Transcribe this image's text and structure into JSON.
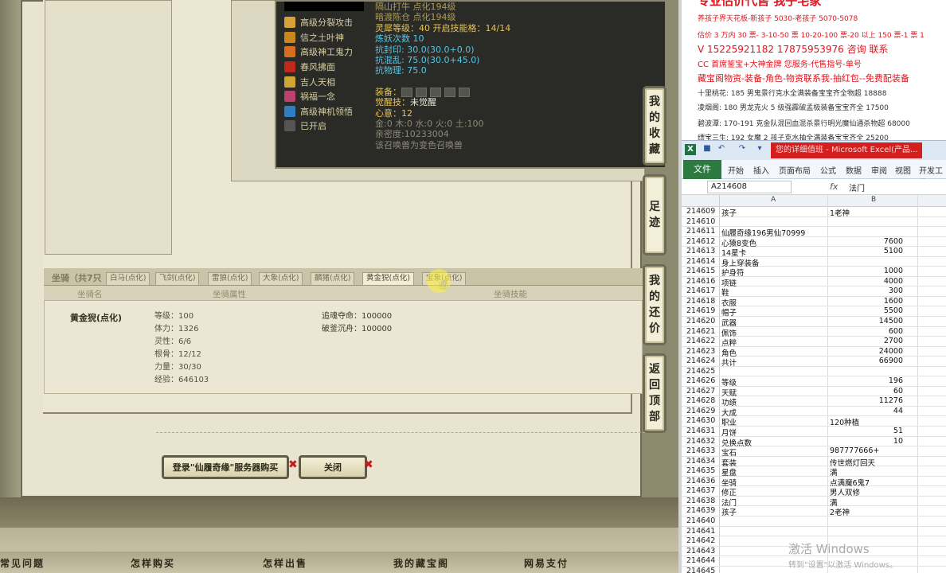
{
  "tooltip": {
    "skills": [
      {
        "label": "高级分裂攻击",
        "color": "#d8a23a"
      },
      {
        "label": "信之土叶神",
        "color": "#c9871e"
      },
      {
        "label": "高级神工鬼力",
        "color": "#d66e1e"
      },
      {
        "label": "春风拂面",
        "color": "#c3281f"
      },
      {
        "label": "吉人天相",
        "color": "#d0a534"
      },
      {
        "label": "祸福一念",
        "color": "#b9436e"
      },
      {
        "label": "高级神机领悟",
        "color": "#2d7fc2"
      },
      {
        "label": "已开启",
        "color": "#555555"
      }
    ],
    "stats": {
      "line1": "隔山打牛 点化194级",
      "line2": "暗渡陈仓 点化194级",
      "level": "灵犀等级：40  开启技能格：14/14",
      "refine": "炼妖次数 10",
      "seal": "抗封印: 30.0(30.0+0.0)",
      "chaos": "抗混乱: 75.0(30.0+45.0)",
      "physical": "抗物理: 75.0",
      "equip": "装备：",
      "awaken_label": "觉醒技：",
      "awaken_value": "未觉醒",
      "mind": "心意：12",
      "elements": "金:0 木:0 水:0 火:0 土:100",
      "intimacy": "亲密度:10233004",
      "note": "该召唤兽为变色召唤兽"
    }
  },
  "side_buttons": [
    {
      "label": [
        "我",
        "的",
        "收",
        "藏"
      ]
    },
    {
      "label": [
        "足",
        "迹"
      ]
    },
    {
      "label": [
        "我",
        "的",
        "还",
        "价"
      ]
    },
    {
      "label": [
        "返",
        "回",
        "顶",
        "部"
      ]
    }
  ],
  "mount": {
    "title": "坐骑（共7只",
    "tabs": [
      "白马(点化)",
      "飞剑(点化)",
      "雷狼(点化)",
      "大象(点化)",
      "麟猪(点化)",
      "黄金猊(点化)",
      "宝象(点化)"
    ],
    "headers": {
      "name": "坐骑名",
      "attrs": "坐骑属性",
      "skills": "坐骑技能"
    },
    "name": "黄金猊(点化)",
    "attrs": [
      "等级：100",
      "体力：1326",
      "灵性：6/6",
      "根骨：12/12",
      "力量：30/30",
      "经验：646103"
    ],
    "skills": [
      "追魂夺命：100000",
      "破釜沉舟：100000"
    ]
  },
  "buttons": {
    "login": "登录\"仙履奇缘\"服务器购买",
    "close": "关闭"
  },
  "footer_nav": [
    "常见问题",
    "怎样购买",
    "怎样出售",
    "我的藏宝阁",
    "网易支付"
  ],
  "notes": {
    "lines": [
      {
        "text": "专业估价代售 我子宅家",
        "cls": "red",
        "size": 15
      },
      {
        "text": "养孩子界天花板-新孩子 5030-老孩子 5070-5078",
        "cls": "red",
        "size": 9
      },
      {
        "text": "估价 3 万内 30 票- 3-10-50 票  10-20-100 票-20 以上 150 票-1 票 1",
        "cls": "red",
        "size": 9
      },
      {
        "text": "V 15225921182     17875953976  咨询  联系",
        "cls": "red",
        "size": 12
      },
      {
        "text": "CC 首席鉴宝+大神金牌   您服务-代售指号-单号",
        "cls": "red",
        "size": 10
      },
      {
        "text": "藏宝阁物资-装备-角色-物资联系我-抽红包--免费配装备",
        "cls": "red",
        "size": 11
      },
      {
        "text": "十里桃花: 185 男鬼景行克水全满装备宝宝齐全物超 18888",
        "cls": "dark",
        "size": 9
      },
      {
        "text": "凌烟阁: 180 男龙克火 5 级强霹破孟极装备宝宝齐全 17500",
        "cls": "dark",
        "size": 9
      },
      {
        "text": "碧波潭: 170-191 克金队混回血混杀景行明光魔仙通杀物超 68000",
        "cls": "dark",
        "size": 9
      },
      {
        "text": "缥宝三生: 192 女魔 2 孩子克水抽全满装备宝宝齐全 25200",
        "cls": "dark",
        "size": 9
      }
    ]
  },
  "excel": {
    "title": "您的详细值班 - Microsoft Excel(产品...",
    "ribbon_tabs": [
      "开始",
      "插入",
      "页面布局",
      "公式",
      "数据",
      "审阅",
      "视图",
      "开发工具"
    ],
    "file_tab": "文件",
    "name_box": "A214608",
    "formula_value": "法门",
    "fx": "fx",
    "col_a": "A",
    "col_b": "B",
    "rows": [
      {
        "n": "214609",
        "a": "孩子",
        "b": "1老神",
        "num": false
      },
      {
        "n": "214610",
        "a": "",
        "b": "",
        "num": false
      },
      {
        "n": "214611",
        "a": "仙履奇缘196男仙70999",
        "b": "",
        "num": false
      },
      {
        "n": "214612",
        "a": "心猿8变色",
        "b": "7600",
        "num": true
      },
      {
        "n": "214613",
        "a": "14星卡",
        "b": "5100",
        "num": true
      },
      {
        "n": "214614",
        "a": "身上穿装备",
        "b": "",
        "num": false
      },
      {
        "n": "214615",
        "a": "护身符",
        "b": "1000",
        "num": true
      },
      {
        "n": "214616",
        "a": "项链",
        "b": "4000",
        "num": true
      },
      {
        "n": "214617",
        "a": "鞋",
        "b": "300",
        "num": true
      },
      {
        "n": "214618",
        "a": "衣服",
        "b": "1600",
        "num": true
      },
      {
        "n": "214619",
        "a": "帽子",
        "b": "5500",
        "num": true
      },
      {
        "n": "214620",
        "a": "武器",
        "b": "14500",
        "num": true
      },
      {
        "n": "214621",
        "a": "佩饰",
        "b": "600",
        "num": true
      },
      {
        "n": "214622",
        "a": "点粹",
        "b": "2700",
        "num": true
      },
      {
        "n": "214623",
        "a": "角色",
        "b": "24000",
        "num": true
      },
      {
        "n": "214624",
        "a": "共计",
        "b": "66900",
        "num": true
      },
      {
        "n": "214625",
        "a": "",
        "b": "",
        "num": false
      },
      {
        "n": "214626",
        "a": "等级",
        "b": "196",
        "num": true
      },
      {
        "n": "214627",
        "a": "天赋",
        "b": "60",
        "num": true
      },
      {
        "n": "214628",
        "a": "功绩",
        "b": "11276",
        "num": true
      },
      {
        "n": "214629",
        "a": "大成",
        "b": "44",
        "num": true
      },
      {
        "n": "214630",
        "a": "职业",
        "b": "120种植",
        "num": false
      },
      {
        "n": "214631",
        "a": "月饼",
        "b": "51",
        "num": true
      },
      {
        "n": "214632",
        "a": "兑换点数",
        "b": "10",
        "num": true
      },
      {
        "n": "214633",
        "a": "宝石",
        "b": "987777666+",
        "num": false
      },
      {
        "n": "214634",
        "a": "套装",
        "b": "传世燃灯回天",
        "num": false
      },
      {
        "n": "214635",
        "a": "星盘",
        "b": "满",
        "num": false
      },
      {
        "n": "214636",
        "a": "坐骑",
        "b": "点满魔6鬼7",
        "num": false
      },
      {
        "n": "214637",
        "a": "修正",
        "b": "男人双修",
        "num": false
      },
      {
        "n": "214638",
        "a": "法门",
        "b": "满",
        "num": false
      },
      {
        "n": "214639",
        "a": "孩子",
        "b": "2老神",
        "num": false
      },
      {
        "n": "214640",
        "a": "",
        "b": "",
        "num": false
      },
      {
        "n": "214641",
        "a": "",
        "b": "",
        "num": false
      },
      {
        "n": "214642",
        "a": "",
        "b": "",
        "num": false
      },
      {
        "n": "214643",
        "a": "",
        "b": "",
        "num": false
      },
      {
        "n": "214644",
        "a": "",
        "b": "",
        "num": false
      },
      {
        "n": "214645",
        "a": "",
        "b": "",
        "num": false
      }
    ],
    "watermark": "激活 Windows",
    "watermark_sub": "转到\"设置\"以激活 Windows。"
  }
}
